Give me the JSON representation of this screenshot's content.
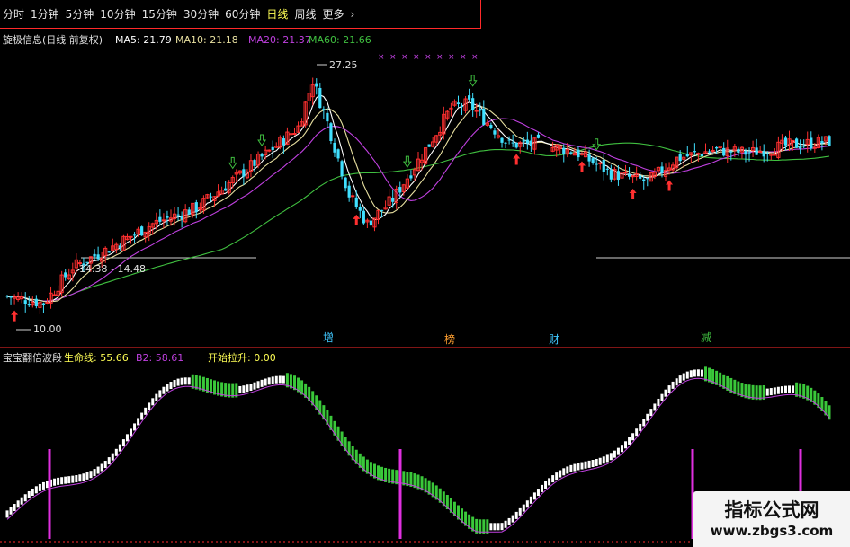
{
  "tabs": [
    "分时",
    "1分钟",
    "5分钟",
    "10分钟",
    "15分钟",
    "30分钟",
    "60分钟",
    "日线",
    "周线",
    "更多"
  ],
  "active_tab": "日线",
  "main_panel": {
    "title": "旋极信息(日线 前复权)",
    "ma5": "MA5: 21.79",
    "ma10": "MA10: 21.18",
    "ma20": "MA20: 21.37",
    "ma60": "MA60: 21.66",
    "high_label": "27.25",
    "low_label": "10.00",
    "range_label": "14.38 - 14.48",
    "date_markers": [
      "增",
      "榜",
      "财",
      "减"
    ]
  },
  "sub_panel": {
    "title": "宝宝翻倍波段",
    "line1": "生命线: 55.66",
    "line2": "B2: 58.61",
    "line3": "开始拉升: 0.00"
  },
  "watermark": {
    "line1": "指标公式网",
    "line2": "www.zbgs3.com"
  },
  "colors": {
    "up": "#ff3030",
    "down": "#40e0ff",
    "ma5": "#ffffff",
    "ma10": "#e8e0a0",
    "ma20": "#c040e0",
    "ma60": "#40c040",
    "accent": "#ffff55"
  },
  "chart_data": [
    {
      "type": "candlestick",
      "title": "旋极信息(日线 前复权)",
      "series": [
        {
          "name": "MA5",
          "last": 21.79
        },
        {
          "name": "MA10",
          "last": 21.18
        },
        {
          "name": "MA20",
          "last": 21.37
        },
        {
          "name": "MA60",
          "last": 21.66
        }
      ],
      "annotations": [
        "27.25",
        "10.00",
        "14.38 - 14.48"
      ],
      "ylim": [
        9.5,
        28.5
      ]
    },
    {
      "type": "bar",
      "title": "宝宝翻倍波段",
      "series": [
        {
          "name": "生命线",
          "last": 55.66
        },
        {
          "name": "B2",
          "last": 58.61
        },
        {
          "name": "开始拉升",
          "last": 0.0
        }
      ],
      "ylim": [
        0,
        100
      ]
    }
  ]
}
